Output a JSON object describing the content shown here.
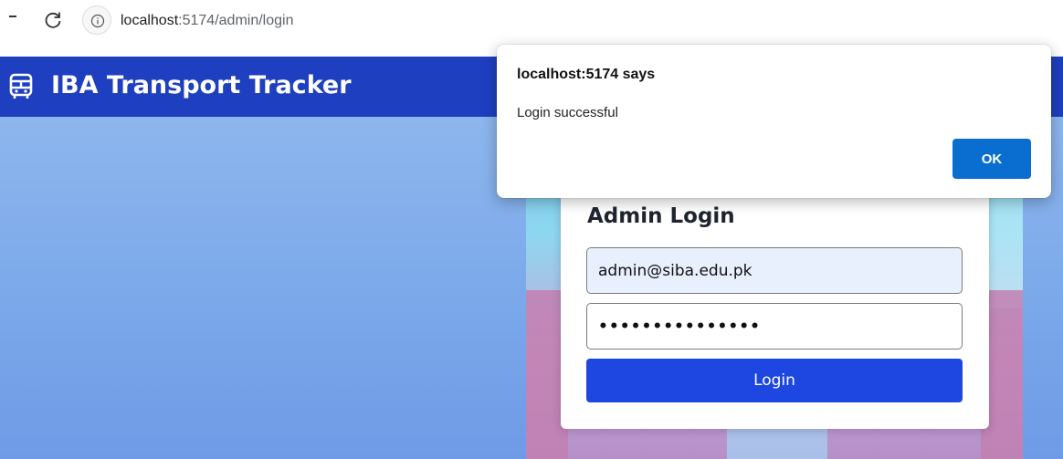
{
  "browser": {
    "url_host": "localhost",
    "url_rest": ":5174/admin/login"
  },
  "header": {
    "title": "IBA Transport Tracker",
    "icon": "bus-icon"
  },
  "login": {
    "title": "Admin Login",
    "email_value": "admin@siba.edu.pk",
    "password_value": "•••••••••••••••",
    "button_label": "Login"
  },
  "dialog": {
    "title": "localhost:5174 says",
    "message": "Login successful",
    "ok_label": "OK"
  },
  "colors": {
    "header_bg": "#1e3fbf",
    "button_bg": "#1d47e0",
    "ok_bg": "#0a6ed1"
  }
}
